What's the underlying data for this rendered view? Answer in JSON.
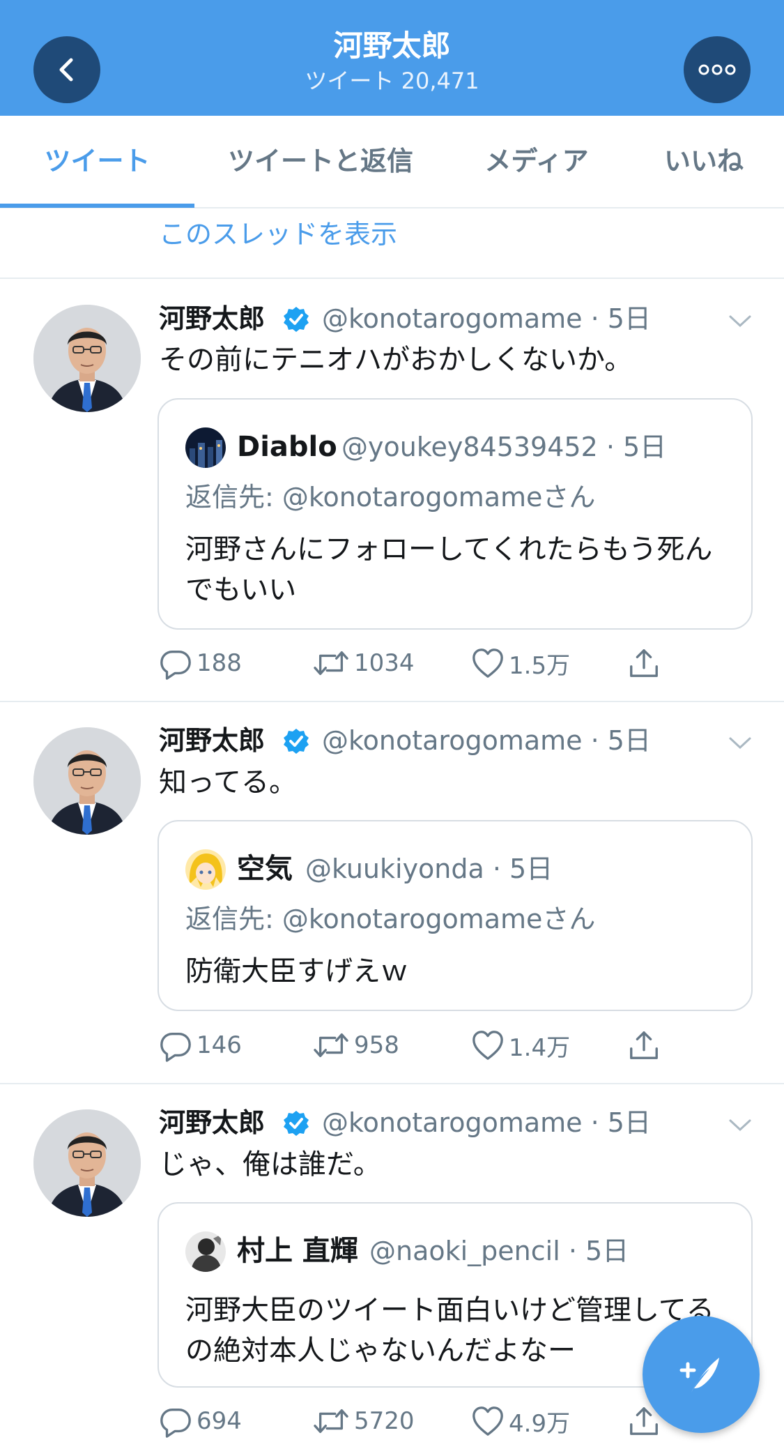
{
  "header": {
    "title": "河野太郎",
    "subtitle": "ツイート 20,471"
  },
  "tabs": [
    {
      "label": "ツイート"
    },
    {
      "label": "ツイートと返信"
    },
    {
      "label": "メディア"
    },
    {
      "label": "いいね"
    }
  ],
  "thread_link": "このスレッドを表示",
  "tweets": [
    {
      "name": "河野太郎",
      "handle": "@konotarogomame · 5日",
      "text": "その前にテニオハがおかしくないか。",
      "quote": {
        "name": "Diablo",
        "handle": "@youkey84539452 · 5日",
        "reply_to": "返信先: @konotarogomameさん",
        "text": "河野さんにフォローしてくれたらもう死んでもいい"
      },
      "replies": "188",
      "retweets": "1034",
      "likes": "1.5万"
    },
    {
      "name": "河野太郎",
      "handle": "@konotarogomame · 5日",
      "text": "知ってる。",
      "quote": {
        "name": "空気",
        "handle": "@kuukiyonda · 5日",
        "reply_to": "返信先: @konotarogomameさん",
        "text": "防衛大臣すげえｗ"
      },
      "replies": "146",
      "retweets": "958",
      "likes": "1.4万"
    },
    {
      "name": "河野太郎",
      "handle": "@konotarogomame · 5日",
      "text": "じゃ、俺は誰だ。",
      "quote": {
        "name": "村上 直輝",
        "handle": "@naoki_pencil · 5日",
        "text": "河野大臣のツイート面白いけど管理してるの絶対本人じゃないんだよなー"
      },
      "replies": "694",
      "retweets": "5720",
      "likes": "4.9万"
    }
  ],
  "colors": {
    "accent": "#4a9cea",
    "header_button": "#1f4a78",
    "secondary_text": "#657786",
    "divider": "#e6ecf0"
  },
  "icons": {
    "back": "chevron-left-icon",
    "more": "more-dots-icon",
    "verified": "verified-badge-icon",
    "caret": "chevron-down-icon",
    "reply": "reply-icon",
    "retweet": "retweet-icon",
    "like": "heart-icon",
    "share": "share-icon",
    "compose": "compose-tweet-icon"
  }
}
